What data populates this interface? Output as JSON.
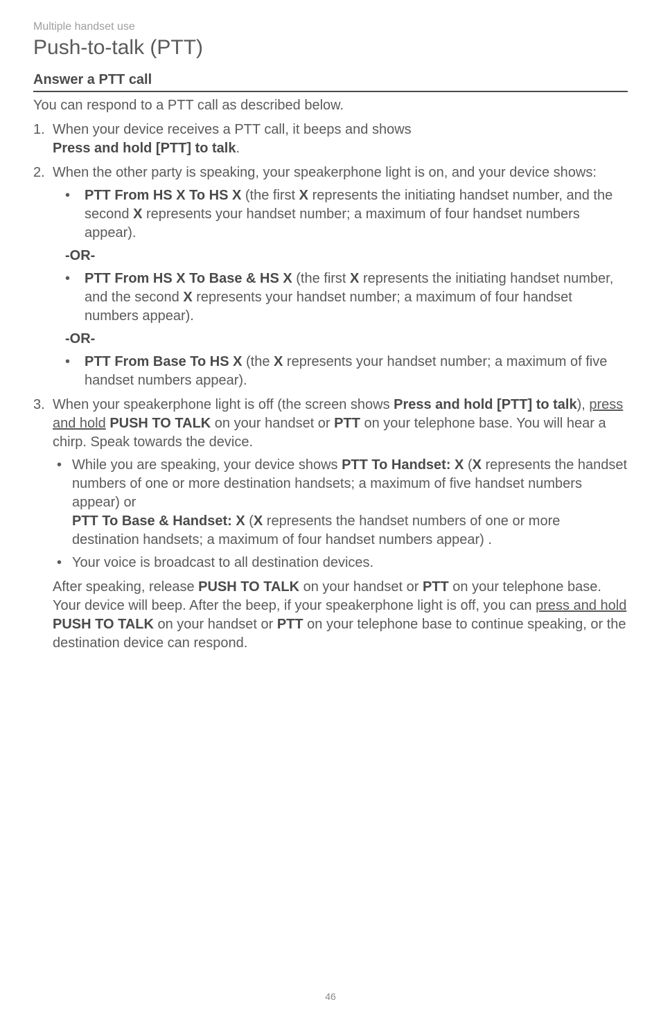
{
  "header": {
    "breadcrumb": "Multiple handset use",
    "title": "Push-to-talk (PTT)"
  },
  "section": {
    "heading": "Answer a PTT call",
    "intro": "You can respond to a PTT call as described below."
  },
  "steps": {
    "s1": {
      "lead": "When your device receives a PTT call, it beeps and shows ",
      "bold": "Press and hold [PTT] to talk",
      "trail": "."
    },
    "s2": {
      "lead": "When the other party is speaking, your speakerphone light is on, and your device shows:",
      "b1": {
        "bold1": "PTT From HS X To HS X",
        "t1": " (the first ",
        "boldX1": "X",
        "t2": " represents the initiating handset number, and the second ",
        "boldX2": "X",
        "t3": " represents your handset number; a maximum of four handset numbers appear)."
      },
      "or": "-OR-",
      "b2": {
        "bold1": "PTT From HS X To Base & HS X",
        "t1": " (the first ",
        "boldX1": "X",
        "t2": " represents the initiating handset number, and the second ",
        "boldX2": "X",
        "t3": " represents your handset number; a maximum of four handset numbers appear)."
      },
      "b3": {
        "bold1": "PTT From Base To HS X",
        "t1": " (the ",
        "boldX1": "X",
        "t2": " represents your handset number; a maximum of five handset numbers appear)."
      }
    },
    "s3": {
      "t1": "When your speakerphone light is off (the screen shows ",
      "bold1": "Press and hold [PTT] to talk",
      "t2": "), ",
      "under1": "press and hold",
      "t3": " ",
      "bold2": "PUSH TO TALK",
      "t4": " on your handset or ",
      "bold3": "PTT",
      "t5": " on your telephone base. You will hear a chirp. Speak towards the device.",
      "b1": {
        "t1": "While you are speaking, your device shows ",
        "bold1": "PTT To Handset: X",
        "t2": " (",
        "boldX1": "X",
        "t3": " represents the handset numbers of one or more destination handsets; a maximum of five handset numbers appear) or ",
        "bold2": "PTT To Base & Handset: X",
        "t4": " (",
        "boldX2": "X",
        "t5": " represents the handset numbers of one or more destination handsets; a maximum of four handset numbers appear) ."
      },
      "b2": "Your voice is broadcast to all destination devices.",
      "after": {
        "t1": "After speaking, release ",
        "bold1": "PUSH TO TALK",
        "t2": " on your handset or ",
        "bold2": "PTT",
        "t3": " on your telephone base. Your device will beep. After the beep, if your speakerphone light is off, you can ",
        "under1": "press and hold",
        "t4": " ",
        "bold3": "PUSH TO TALK",
        "t5": " on your handset or ",
        "bold4": "PTT",
        "t6": " on your telephone base to continue speaking, or the destination device can respond."
      }
    }
  },
  "pageNumber": "46"
}
